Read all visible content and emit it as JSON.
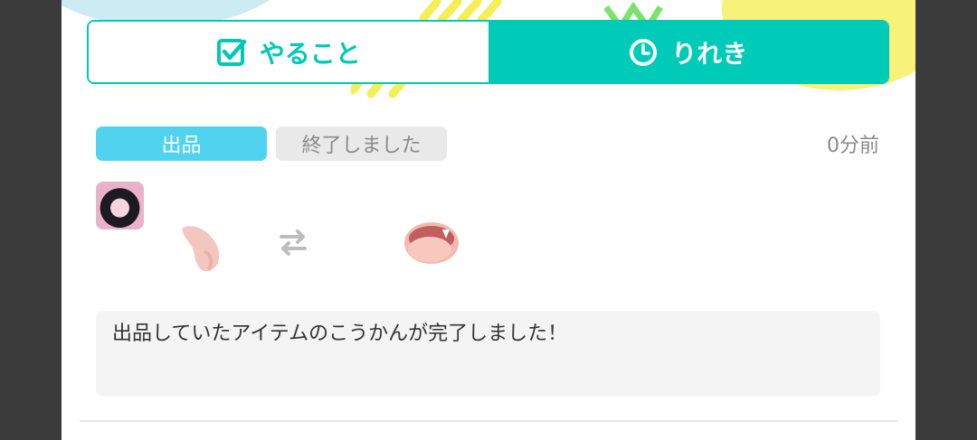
{
  "tabs": {
    "todo_label": "やること",
    "history_label": "りれき",
    "active": "history"
  },
  "entry": {
    "badge_listing": "出品",
    "badge_status": "終了しました",
    "timestamp": "0分前",
    "message": "出品していたアイテムのこうかんが完了しました！"
  },
  "icons": {
    "todo_tab": "checkbox-icon",
    "history_tab": "clock-icon",
    "exchange": "exchange-arrows-icon"
  },
  "colors": {
    "accent": "#00cbb8",
    "badge_listing": "#4fd3ef",
    "badge_status": "#e9e9e9"
  }
}
